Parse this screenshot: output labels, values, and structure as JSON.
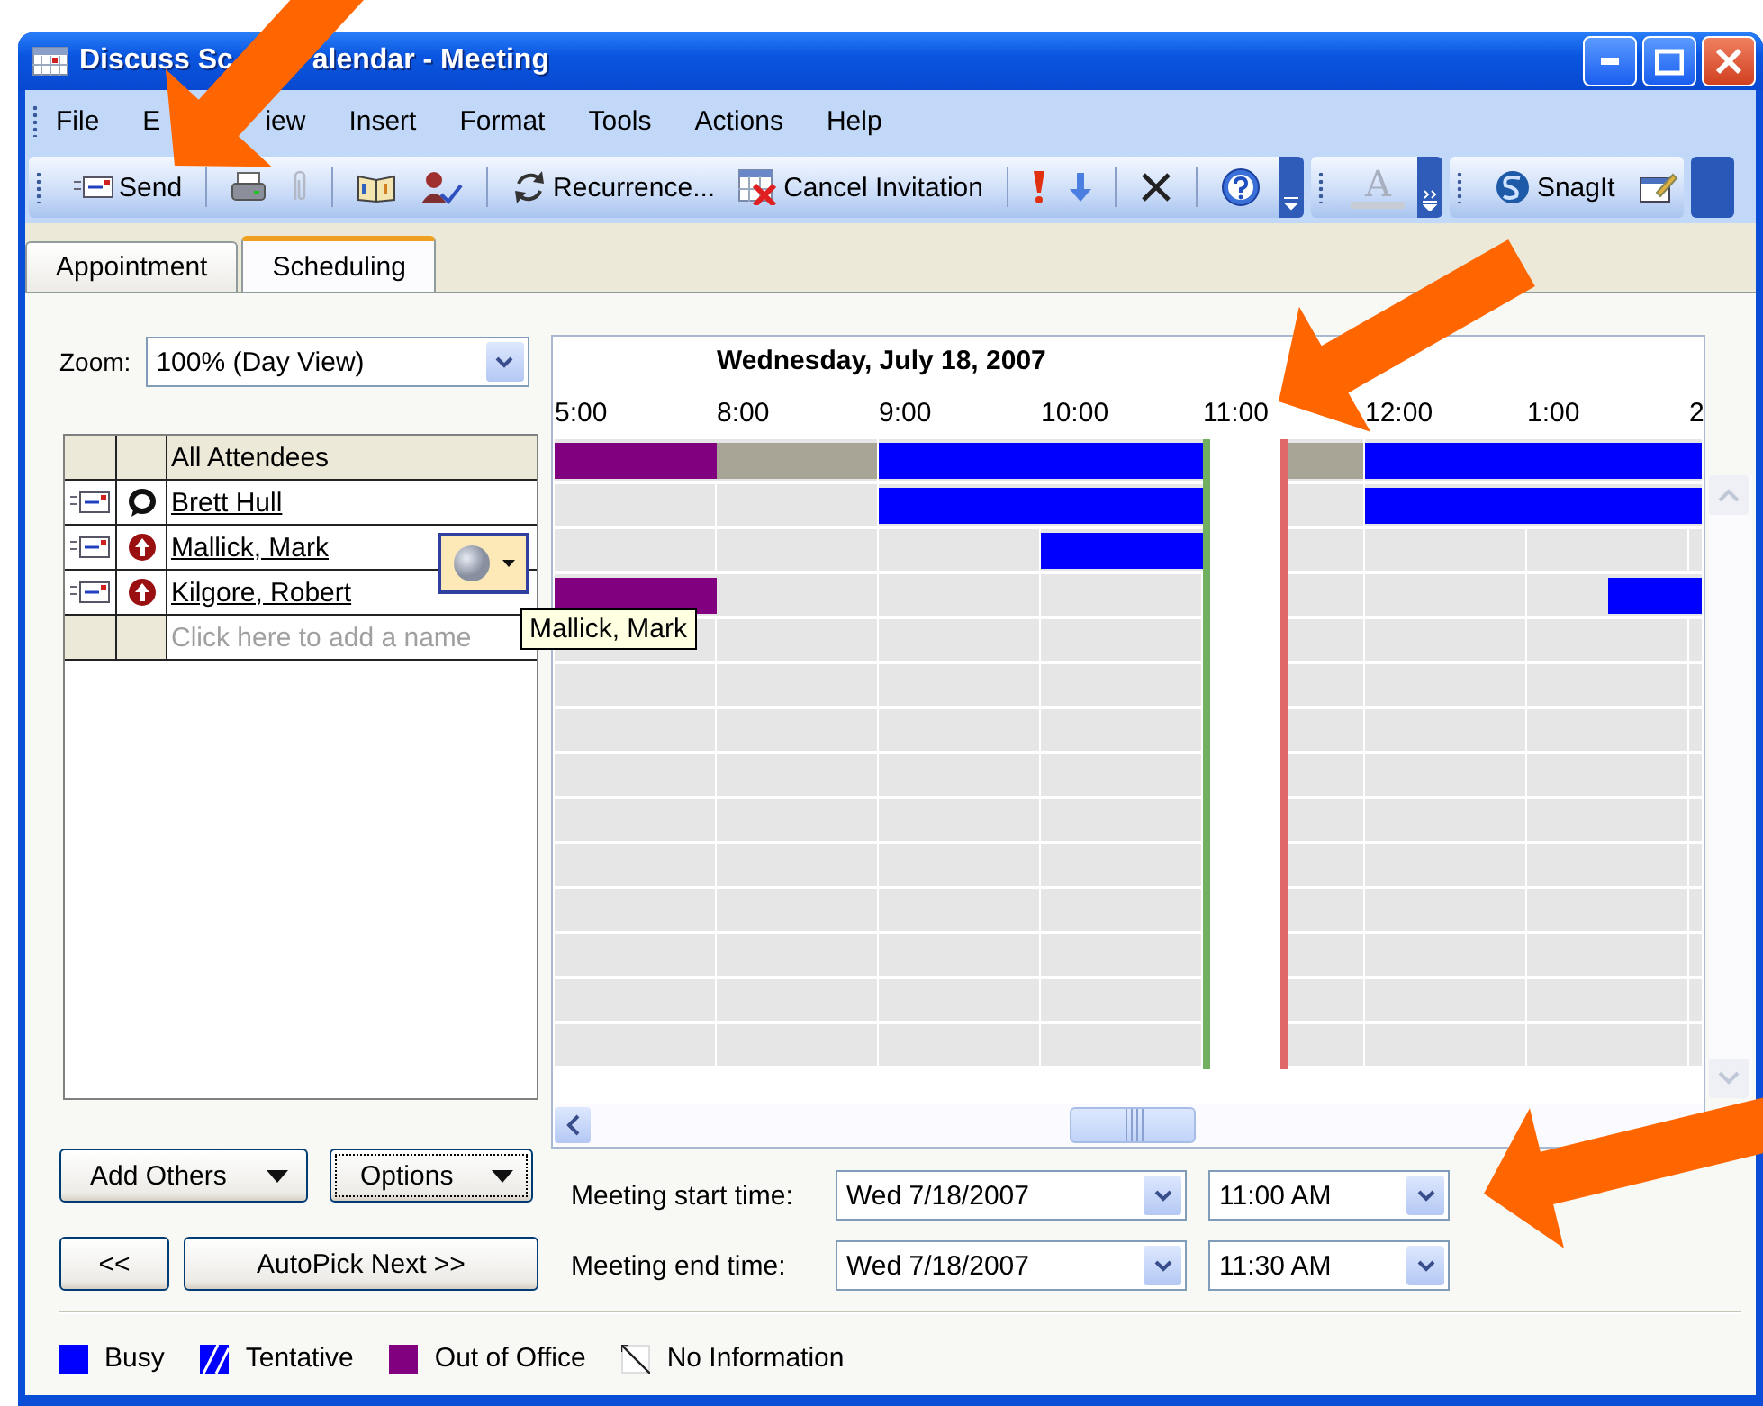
{
  "window": {
    "title_parts": [
      "Discuss Sc",
      "alendar - Meeting"
    ]
  },
  "menu": [
    {
      "label": "File"
    },
    {
      "label": "E"
    },
    {
      "label": "iew"
    },
    {
      "label": "Insert"
    },
    {
      "label": "Format"
    },
    {
      "label": "Tools"
    },
    {
      "label": "Actions"
    },
    {
      "label": "Help"
    }
  ],
  "toolbar": {
    "send": "Send",
    "recurrence": "Recurrence...",
    "cancel": "Cancel Invitation",
    "font_color": "A",
    "snagit": "SnagIt"
  },
  "tabs": [
    {
      "label": "Appointment",
      "selected": false
    },
    {
      "label": "Scheduling",
      "selected": true
    }
  ],
  "zoom": {
    "label": "Zoom:",
    "value": "100% (Day View)"
  },
  "timeline": {
    "date": "Wednesday, July 18, 2007",
    "hours": [
      "5:00",
      "8:00",
      "9:00",
      "10:00",
      "11:00",
      "12:00",
      "1:00",
      "2"
    ]
  },
  "attendees": {
    "header": "All Attendees",
    "header_slots": [
      {
        "kind": "oof",
        "selected": false
      },
      {
        "kind": "oof",
        "selected": false
      },
      {
        "kind": "other",
        "selected": false
      },
      {
        "kind": "other",
        "selected": false
      },
      {
        "kind": "busy",
        "selected": false
      },
      {
        "kind": "busy",
        "selected": false
      },
      {
        "kind": "busy",
        "selected": false
      },
      {
        "kind": "busy",
        "selected": false
      },
      {
        "kind": "free",
        "selected": true
      },
      {
        "kind": "other",
        "selected": false
      },
      {
        "kind": "busy",
        "selected": false
      },
      {
        "kind": "busy",
        "selected": false
      },
      {
        "kind": "busy",
        "selected": false
      },
      {
        "kind": "busy",
        "selected": false
      },
      {
        "kind": "busy",
        "selected": false
      }
    ],
    "rows": [
      {
        "name": "Brett Hull",
        "kind": "organizer",
        "slots": [
          {
            "kind": "free"
          },
          {
            "kind": "free"
          },
          {
            "kind": "free"
          },
          {
            "kind": "free"
          },
          {
            "kind": "busy"
          },
          {
            "kind": "busy"
          },
          {
            "kind": "busy"
          },
          {
            "kind": "busy"
          },
          {
            "kind": "free"
          },
          {
            "kind": "free"
          },
          {
            "kind": "busy"
          },
          {
            "kind": "busy"
          },
          {
            "kind": "busy"
          },
          {
            "kind": "busy"
          },
          {
            "kind": "busy"
          }
        ]
      },
      {
        "name": "Mallick, Mark",
        "kind": "required",
        "slots": [
          {
            "kind": "free"
          },
          {
            "kind": "free"
          },
          {
            "kind": "free"
          },
          {
            "kind": "free"
          },
          {
            "kind": "free"
          },
          {
            "kind": "free"
          },
          {
            "kind": "busy"
          },
          {
            "kind": "busy"
          },
          {
            "kind": "free"
          },
          {
            "kind": "free"
          },
          {
            "kind": "free"
          },
          {
            "kind": "free"
          },
          {
            "kind": "free"
          },
          {
            "kind": "free"
          },
          {
            "kind": "free"
          }
        ]
      },
      {
        "name": "Kilgore, Robert",
        "kind": "required",
        "slots": [
          {
            "kind": "oof"
          },
          {
            "kind": "oof"
          },
          {
            "kind": "free"
          },
          {
            "kind": "free"
          },
          {
            "kind": "free"
          },
          {
            "kind": "free"
          },
          {
            "kind": "free"
          },
          {
            "kind": "free"
          },
          {
            "kind": "free"
          },
          {
            "kind": "free"
          },
          {
            "kind": "free"
          },
          {
            "kind": "free"
          },
          {
            "kind": "free"
          },
          {
            "kind": "busy"
          },
          {
            "kind": "busy"
          }
        ]
      }
    ],
    "add_placeholder": "Click here to add a name"
  },
  "tooltip": "Mallick, Mark",
  "buttons": {
    "add_others": "Add Others",
    "options": "Options",
    "previous": "<<",
    "autopick": "AutoPick Next >>"
  },
  "meeting": [
    {
      "label": "Meeting start time:",
      "date": "Wed 7/18/2007",
      "time": "11:00 AM"
    },
    {
      "label": "Meeting end time:",
      "date": "Wed 7/18/2007",
      "time": "11:30 AM"
    }
  ],
  "legend": [
    {
      "label": "Busy",
      "kind": "busy"
    },
    {
      "label": "Tentative",
      "kind": "tentative"
    },
    {
      "label": "Out of Office",
      "kind": "oof"
    },
    {
      "label": "No Information",
      "kind": "noinfo"
    }
  ]
}
